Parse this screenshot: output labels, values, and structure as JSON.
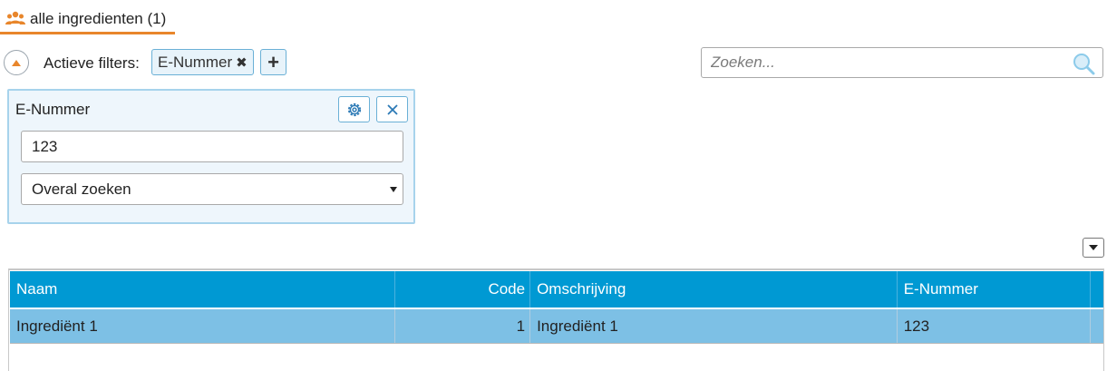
{
  "tab": {
    "icon": "users-icon",
    "label": "alle ingredienten (1)"
  },
  "filters": {
    "label": "Actieve filters:",
    "chips": [
      {
        "label": "E-Nummer",
        "remove_icon": "close-x-icon"
      }
    ],
    "add_label": "+"
  },
  "search": {
    "placeholder": "Zoeken...",
    "value": ""
  },
  "filter_panel": {
    "title": "E-Nummer",
    "input_value": "123",
    "select_value": "Overal zoeken"
  },
  "table": {
    "columns": [
      "Naam",
      "Code",
      "Omschrijving",
      "E-Nummer"
    ],
    "rows": [
      [
        "Ingrediënt 1",
        "1",
        "Ingrediënt 1",
        "123"
      ]
    ]
  },
  "colors": {
    "accent": "#e8862b",
    "header": "#0099d3",
    "selected_row": "#7dc0e5",
    "panel_border": "#a7d3ec"
  }
}
